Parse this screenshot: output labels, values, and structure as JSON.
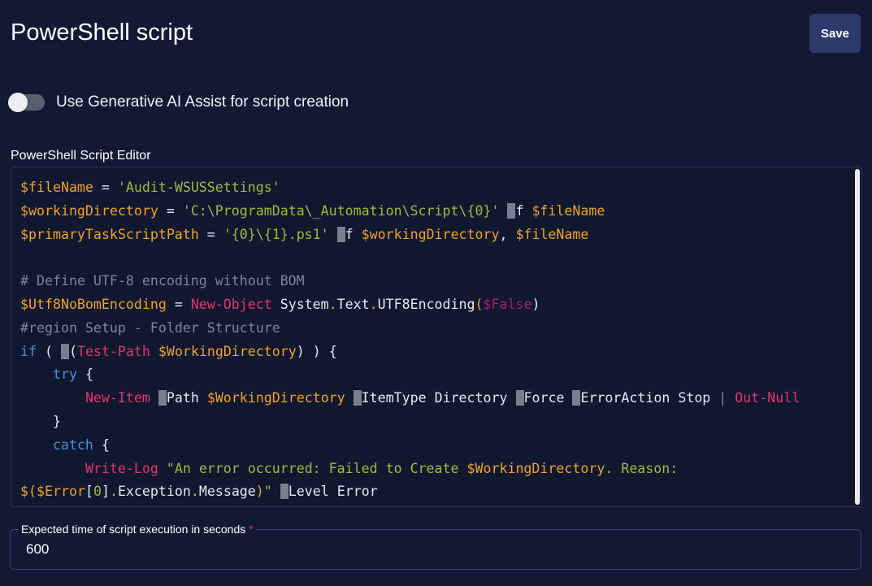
{
  "header": {
    "title": "PowerShell script",
    "save_label": "Save"
  },
  "ai_assist": {
    "label": "Use Generative AI Assist for script creation",
    "enabled": false
  },
  "editor": {
    "label": "PowerShell Script Editor",
    "lines": [
      [
        [
          "v",
          "$fileName"
        ],
        [
          "t",
          " = "
        ],
        [
          "s",
          "'Audit-WSUSSettings'"
        ]
      ],
      [
        [
          "v",
          "$workingDirectory"
        ],
        [
          "t",
          " = "
        ],
        [
          "s",
          "'C:\\ProgramData\\_Automation\\Script\\{0}'"
        ],
        [
          "t",
          " "
        ],
        [
          "d",
          "-"
        ],
        [
          "t",
          "f "
        ],
        [
          "v",
          "$fileName"
        ]
      ],
      [
        [
          "v",
          "$primaryTaskScriptPath"
        ],
        [
          "t",
          " = "
        ],
        [
          "s",
          "'{0}\\{1}.ps1'"
        ],
        [
          "t",
          " "
        ],
        [
          "d",
          "-"
        ],
        [
          "t",
          "f "
        ],
        [
          "v",
          "$workingDirectory"
        ],
        [
          "t",
          ", "
        ],
        [
          "v",
          "$fileName"
        ]
      ],
      [],
      [
        [
          "c",
          "# Define UTF-8 encoding without BOM"
        ]
      ],
      [
        [
          "v",
          "$Utf8NoBomEncoding"
        ],
        [
          "t",
          " = "
        ],
        [
          "cm",
          "New-Object"
        ],
        [
          "t",
          " System"
        ],
        [
          "v",
          "."
        ],
        [
          "t",
          "Text"
        ],
        [
          "v",
          "."
        ],
        [
          "t",
          "UTF8Encoding"
        ],
        [
          "v",
          "("
        ],
        [
          "b",
          "$False"
        ],
        [
          "t",
          ")"
        ]
      ],
      [
        [
          "c",
          "#region Setup - Folder Structure"
        ]
      ],
      [
        [
          "k",
          "if"
        ],
        [
          "t",
          " ( "
        ],
        [
          "d",
          "!"
        ],
        [
          "t",
          "("
        ],
        [
          "cm",
          "Test-Path"
        ],
        [
          "t",
          " "
        ],
        [
          "v",
          "$WorkingDirectory"
        ],
        [
          "t",
          ") ) {"
        ]
      ],
      [
        [
          "t",
          "    "
        ],
        [
          "k",
          "try"
        ],
        [
          "t",
          " {"
        ]
      ],
      [
        [
          "t",
          "        "
        ],
        [
          "cm",
          "New-Item"
        ],
        [
          "t",
          " "
        ],
        [
          "d",
          "-"
        ],
        [
          "t",
          "Path "
        ],
        [
          "v",
          "$WorkingDirectory"
        ],
        [
          "t",
          " "
        ],
        [
          "d",
          "-"
        ],
        [
          "t",
          "ItemType Directory "
        ],
        [
          "d",
          "-"
        ],
        [
          "t",
          "Force "
        ],
        [
          "d",
          "-"
        ],
        [
          "t",
          "ErrorAction Stop "
        ],
        [
          "c",
          "|"
        ],
        [
          "t",
          " "
        ],
        [
          "cm",
          "Out-Null"
        ]
      ],
      [
        [
          "t",
          "    }"
        ]
      ],
      [
        [
          "t",
          "    "
        ],
        [
          "k",
          "catch"
        ],
        [
          "t",
          " {"
        ]
      ],
      [
        [
          "t",
          "        "
        ],
        [
          "cm",
          "Write-Log"
        ],
        [
          "t",
          " "
        ],
        [
          "s",
          "\"An error occurred: Failed to Create "
        ],
        [
          "v",
          "$WorkingDirectory"
        ],
        [
          "s",
          ". Reason:"
        ]
      ],
      [
        [
          "v",
          "$("
        ],
        [
          "v",
          "$Error"
        ],
        [
          "t",
          "["
        ],
        [
          "s",
          "0"
        ],
        [
          "t",
          "]"
        ],
        [
          "v",
          "."
        ],
        [
          "t",
          "Exception"
        ],
        [
          "v",
          "."
        ],
        [
          "t",
          "Message"
        ],
        [
          "v",
          ")"
        ],
        [
          "s",
          "\""
        ],
        [
          "t",
          " "
        ],
        [
          "d",
          "-"
        ],
        [
          "t",
          "Level Error"
        ]
      ]
    ]
  },
  "timeout": {
    "label": "Expected time of script execution in seconds",
    "required_mark": "*",
    "value": "600"
  }
}
